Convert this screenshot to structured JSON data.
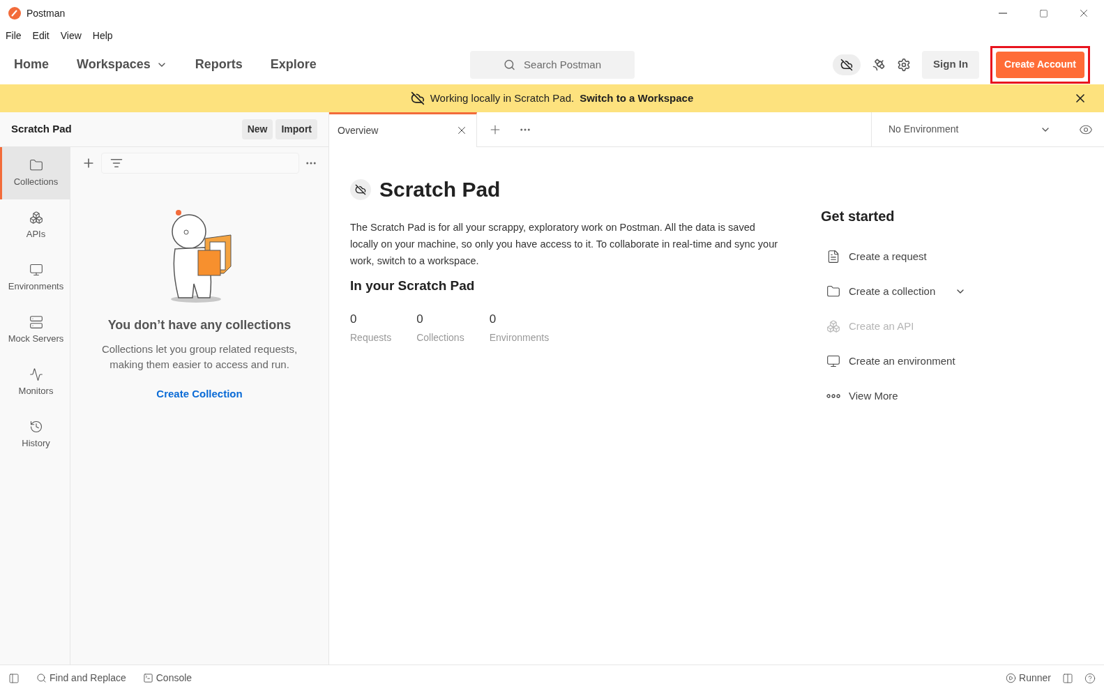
{
  "window": {
    "title": "Postman"
  },
  "menu": [
    "File",
    "Edit",
    "View",
    "Help"
  ],
  "nav": [
    {
      "label": "Home",
      "has_menu": false
    },
    {
      "label": "Workspaces",
      "has_menu": true
    },
    {
      "label": "Reports",
      "has_menu": false
    },
    {
      "label": "Explore",
      "has_menu": false
    }
  ],
  "search": {
    "placeholder": "Search Postman"
  },
  "header_buttons": {
    "sign_in": "Sign In",
    "create_account": "Create Account",
    "highlighted": true
  },
  "banner": {
    "text": "Working locally in Scratch Pad.",
    "link": "Switch to a Workspace"
  },
  "panel": {
    "title": "Scratch Pad",
    "buttons": [
      "New",
      "Import"
    ]
  },
  "sidebar": {
    "items": [
      {
        "label": "Collections",
        "kind": "collections",
        "selected": true
      },
      {
        "label": "APIs",
        "kind": "apis",
        "selected": false
      },
      {
        "label": "Environments",
        "kind": "environments",
        "selected": false
      },
      {
        "label": "Mock Servers",
        "kind": "mock",
        "selected": false
      },
      {
        "label": "Monitors",
        "kind": "monitors",
        "selected": false
      },
      {
        "label": "History",
        "kind": "history",
        "selected": false
      }
    ]
  },
  "empty_state": {
    "title": "You don’t have any collections",
    "text": "Collections let you group related requests, making them easier to access and run.",
    "action": "Create Collection"
  },
  "tabs": [
    {
      "label": "Overview",
      "selected": true
    }
  ],
  "environment": {
    "value": "No Environment"
  },
  "overview": {
    "title": "Scratch Pad",
    "description": "The Scratch Pad is for all your scrappy, exploratory work on Postman. All the data is saved locally on your machine, so only you have access to it. To collaborate in real-time and sync your work, switch to a workspace.",
    "section": "In your Scratch Pad",
    "stats": [
      {
        "value": "0",
        "label": "Requests"
      },
      {
        "value": "0",
        "label": "Collections"
      },
      {
        "value": "0",
        "label": "Environments"
      }
    ]
  },
  "get_started": {
    "title": "Get started",
    "items": [
      {
        "label": "Create a request",
        "kind": "request",
        "disabled": false,
        "has_menu": false
      },
      {
        "label": "Create a collection",
        "kind": "collection",
        "disabled": false,
        "has_menu": true
      },
      {
        "label": "Create an API",
        "kind": "api",
        "disabled": true,
        "has_menu": false
      },
      {
        "label": "Create an environment",
        "kind": "environment",
        "disabled": false,
        "has_menu": false
      },
      {
        "label": "View More",
        "kind": "more",
        "disabled": false,
        "has_menu": false
      }
    ]
  },
  "status_bar": {
    "left": [
      {
        "label": "Find and Replace",
        "kind": "find"
      },
      {
        "label": "Console",
        "kind": "console"
      }
    ],
    "right": [
      {
        "label": "Runner",
        "kind": "runner"
      }
    ]
  }
}
